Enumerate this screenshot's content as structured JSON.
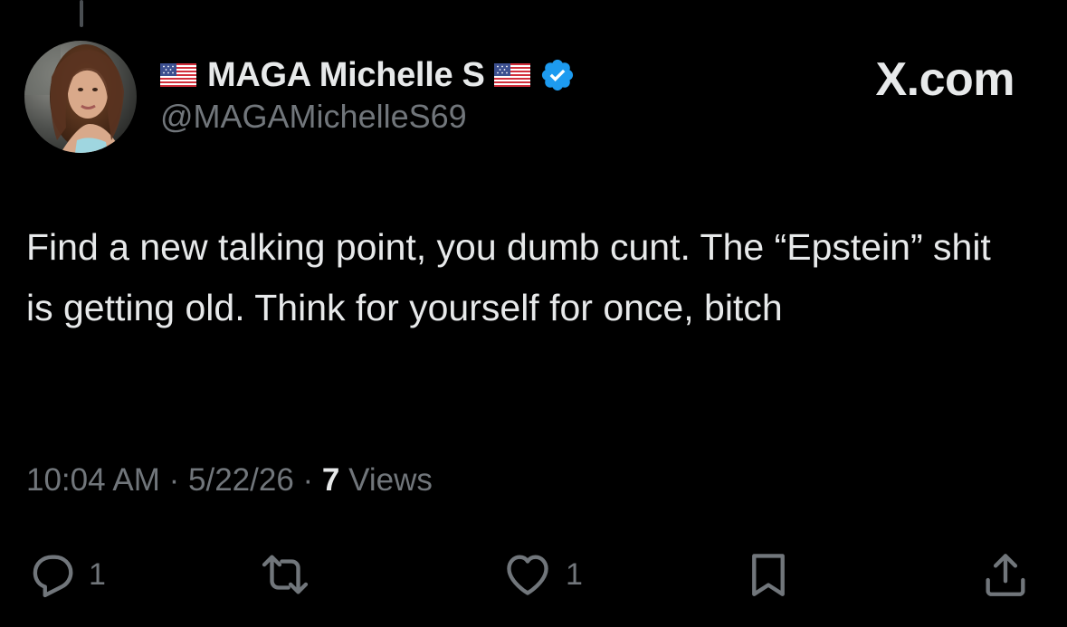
{
  "thread": {
    "connector": "reply-thread-line"
  },
  "author": {
    "avatar_icon": "profile-photo",
    "flag_icon": "us-flag-icon",
    "display_name": "MAGA Michelle S",
    "verified_icon": "verified-badge-icon",
    "verified_color": "#1d9bf0",
    "handle": "@MAGAMichelleS69"
  },
  "brand": {
    "label": "X.com"
  },
  "tweet": {
    "text": "Find a new talking point, you dumb cunt. The “Epstein” shit is getting old. Think for yourself for once, bitch"
  },
  "meta": {
    "time": "10:04 AM",
    "separator": "·",
    "date": "5/22/26",
    "views_count": "7",
    "views_label": "Views"
  },
  "actions": {
    "reply": {
      "icon": "reply-icon",
      "count": "1"
    },
    "repost": {
      "icon": "repost-icon"
    },
    "like": {
      "icon": "heart-icon",
      "count": "1"
    },
    "bookmark": {
      "icon": "bookmark-icon"
    },
    "share": {
      "icon": "share-icon"
    }
  },
  "colors": {
    "background": "#000000",
    "text_primary": "#e7e9ea",
    "text_secondary": "#71767b"
  }
}
